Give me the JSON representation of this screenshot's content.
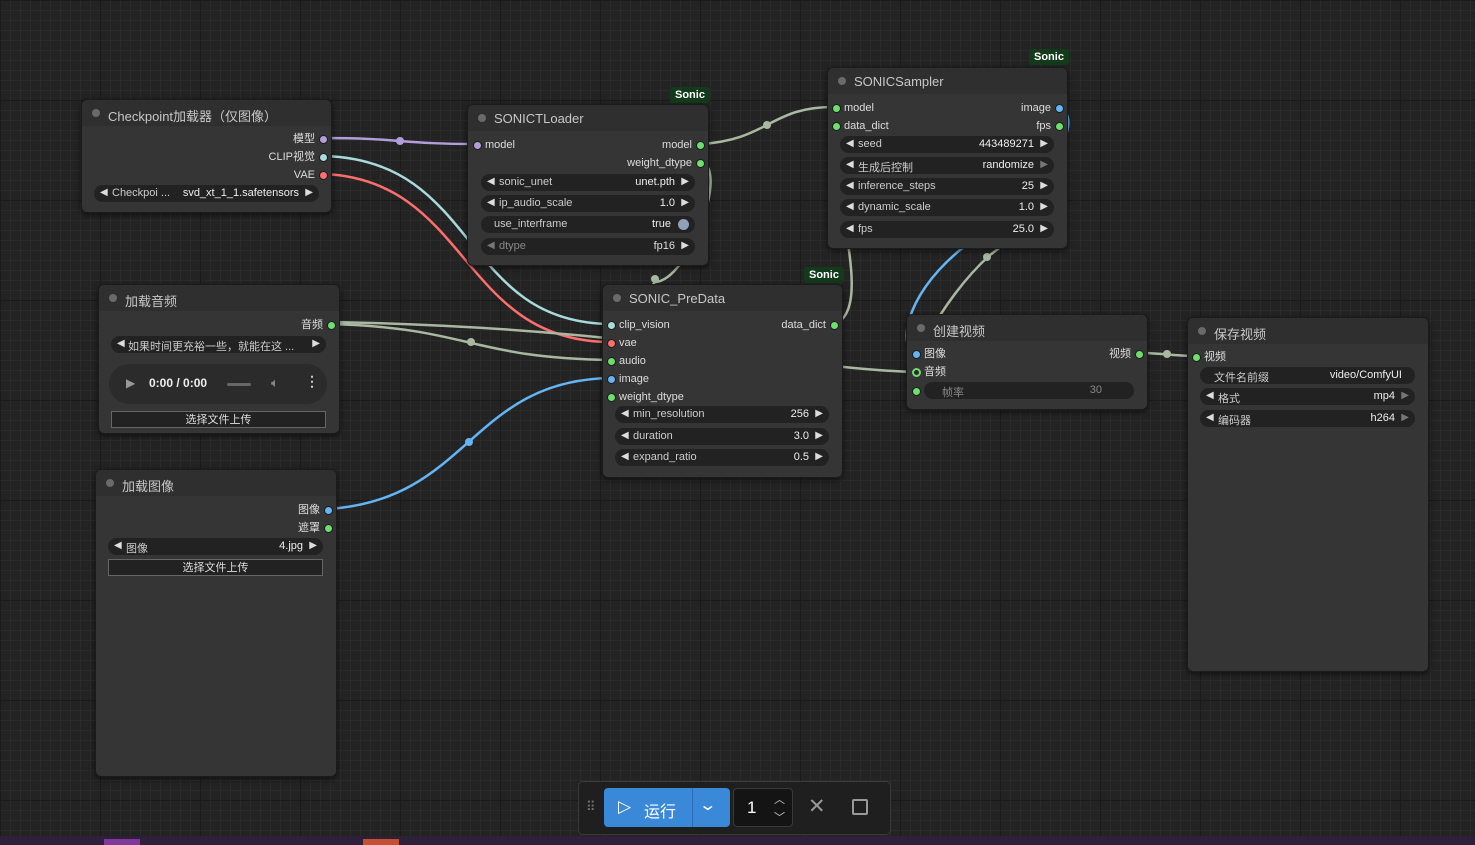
{
  "nodes": {
    "checkpoint": {
      "title": "Checkpoint加载器（仅图像）",
      "outputs": [
        "模型",
        "CLIP视觉",
        "VAE"
      ],
      "widget": {
        "name": "Checkpoi ...",
        "value": "svd_xt_1_1.safetensors"
      }
    },
    "loader": {
      "title": "SONICTLoader",
      "badge": "Sonic",
      "input": "model",
      "outputs": [
        "model",
        "weight_dtype"
      ],
      "widgets": [
        {
          "name": "sonic_unet",
          "value": "unet.pth"
        },
        {
          "name": "ip_audio_scale",
          "value": "1.0"
        },
        {
          "name": "use_interframe",
          "value": "true"
        },
        {
          "name": "dtype",
          "value": "fp16"
        }
      ]
    },
    "sampler": {
      "title": "SONICSampler",
      "badge": "Sonic",
      "inputs": [
        "model",
        "data_dict"
      ],
      "outputs": [
        "image",
        "fps"
      ],
      "widgets": [
        {
          "name": "seed",
          "value": "443489271"
        },
        {
          "name": "生成后控制",
          "value": "randomize"
        },
        {
          "name": "inference_steps",
          "value": "25"
        },
        {
          "name": "dynamic_scale",
          "value": "1.0"
        },
        {
          "name": "fps",
          "value": "25.0"
        }
      ]
    },
    "audio": {
      "title": "加载音频",
      "output": "音频",
      "file": "如果时间更充裕一些，就能在这 ...",
      "time": "0:00 / 0:00",
      "upload": "选择文件上传"
    },
    "predata": {
      "title": "SONIC_PreData",
      "badge": "Sonic",
      "inputs": [
        "clip_vision",
        "vae",
        "audio",
        "image",
        "weight_dtype"
      ],
      "output": "data_dict",
      "widgets": [
        {
          "name": "min_resolution",
          "value": "256"
        },
        {
          "name": "duration",
          "value": "3.0"
        },
        {
          "name": "expand_ratio",
          "value": "0.5"
        }
      ]
    },
    "image": {
      "title": "加载图像",
      "outputs": [
        "图像",
        "遮罩"
      ],
      "widget": {
        "name": "图像",
        "value": "4.jpg"
      },
      "upload": "选择文件上传"
    },
    "video": {
      "title": "创建视频",
      "inputs": [
        "图像",
        "音频"
      ],
      "output": "视频",
      "widget": {
        "name": "帧率",
        "value": "30"
      }
    },
    "save": {
      "title": "保存视频",
      "input": "视频",
      "widgets": [
        {
          "name": "文件名前缀",
          "value": "video/ComfyUI"
        },
        {
          "name": "格式",
          "value": "mp4"
        },
        {
          "name": "编码器",
          "value": "h264"
        }
      ]
    }
  },
  "toolbar": {
    "run_label": "运行",
    "count": "1"
  },
  "colors": {
    "model": "#b39ddb",
    "clip_vision": "#a8dadc",
    "vae": "#ff6e6e",
    "audio": "#a9b8a0",
    "image": "#64b5f6",
    "data": "#98c097",
    "green_socket": "#6ddf6d"
  }
}
